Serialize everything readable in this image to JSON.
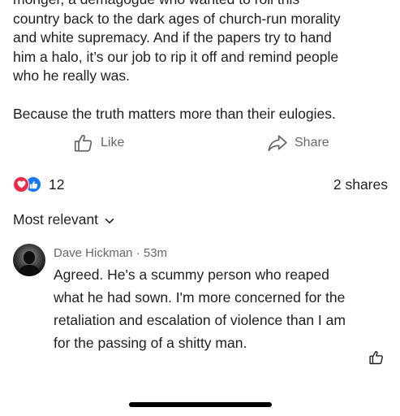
{
  "post": {
    "lines": [
      "monger, a demagogue who wanted to roll this",
      "country back to the dark ages of church-run morality",
      "and white supremacy. And if the papers try to hand",
      "him a halo, it’s our job to rip it off and remind people",
      "who he really was."
    ],
    "closing": "Because the truth matters more than their eulogies."
  },
  "actions": {
    "like_label": "Like",
    "share_label": "Share"
  },
  "reactions": {
    "count": "12",
    "types": [
      "love",
      "like"
    ],
    "shares": "2 shares"
  },
  "sort": {
    "label": "Most relevant"
  },
  "comment": {
    "author": "Dave Hickman",
    "separator": " · ",
    "time": "53m",
    "lines": [
      "Agreed. He's a scummy person who reaped",
      "what he had sown. I'm more concerned for the",
      "retaliation and escalation of violence than I am",
      "for the passing of a shitty man."
    ]
  },
  "colors": {
    "text": "#1c1e21",
    "secondary": "#65676b",
    "love": "#f0284a",
    "like": "#1877f2"
  }
}
